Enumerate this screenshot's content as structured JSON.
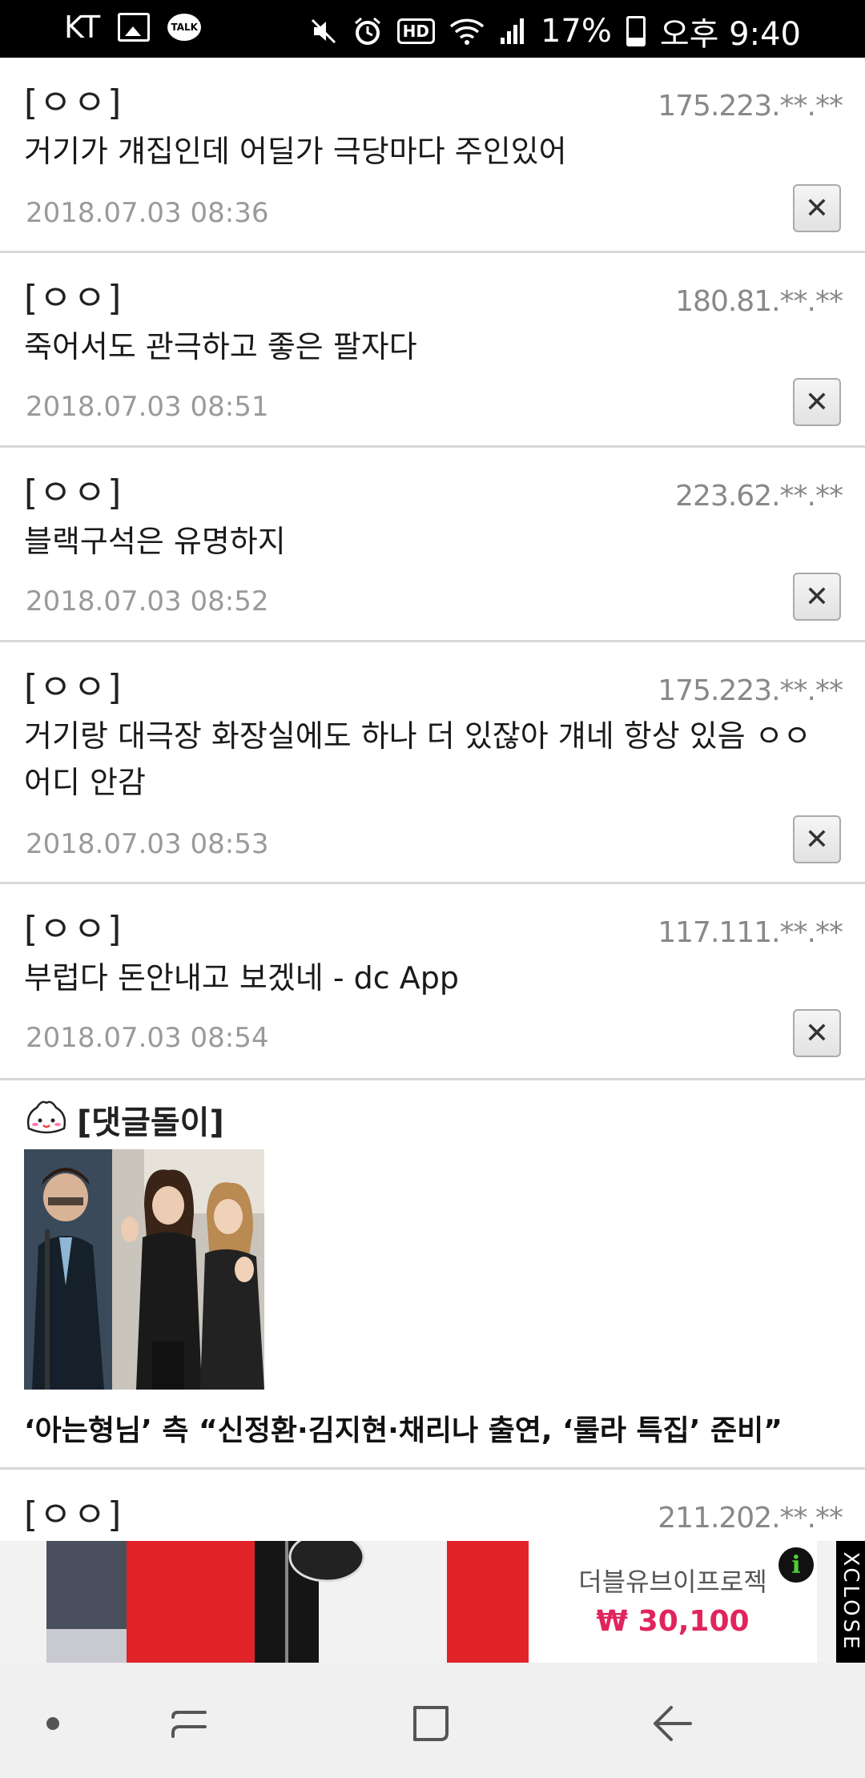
{
  "status_bar": {
    "carrier": "KT",
    "battery": "17%",
    "time": "오후 9:40",
    "icons": [
      "image-icon",
      "kakaotalk-icon",
      "mute-icon",
      "alarm-icon",
      "hd-icon",
      "wifi-icon",
      "signal-icon",
      "battery-icon"
    ],
    "talk_label": "TALK",
    "hd_label": "HD"
  },
  "comments": [
    {
      "author": "[ㅇㅇ]",
      "ip": "175.223.**.**",
      "text": "거기가 걔집인데 어딜가 극당마다 주인있어",
      "date": "2018.07.03 08:36"
    },
    {
      "author": "[ㅇㅇ]",
      "ip": "180.81.**.**",
      "text": "죽어서도 관극하고 좋은 팔자다",
      "date": "2018.07.03 08:51"
    },
    {
      "author": "[ㅇㅇ]",
      "ip": "223.62.**.**",
      "text": "블랙구석은 유명하지",
      "date": "2018.07.03 08:52"
    },
    {
      "author": "[ㅇㅇ]",
      "ip": "175.223.**.**",
      "text": "거기랑 대극장 화장실에도 하나 더 있잖아 걔네 항상 있음 ㅇㅇ 어디 안감",
      "date": "2018.07.03 08:53"
    },
    {
      "author": "[ㅇㅇ]",
      "ip": "117.111.**.**",
      "text": "부럽다 돈안내고 보겠네 - dc App",
      "date": "2018.07.03 08:54"
    }
  ],
  "delete_label": "✕",
  "bot": {
    "label": "[댓글돌이]",
    "headline": "‘아는형님’ 측 “신정환·김지현·채리나 출연, ‘룰라 특집’ 준비”"
  },
  "partial_comment": {
    "author": "[ㅇㅇ]",
    "ip": "211.202.**.**"
  },
  "ad": {
    "brand": "더블유브이프로젝",
    "price": "₩ 30,100",
    "info": "i",
    "close": "XCLOSE"
  },
  "nav": [
    "recent-apps-dot-icon",
    "recents-icon",
    "home-icon",
    "back-icon"
  ]
}
